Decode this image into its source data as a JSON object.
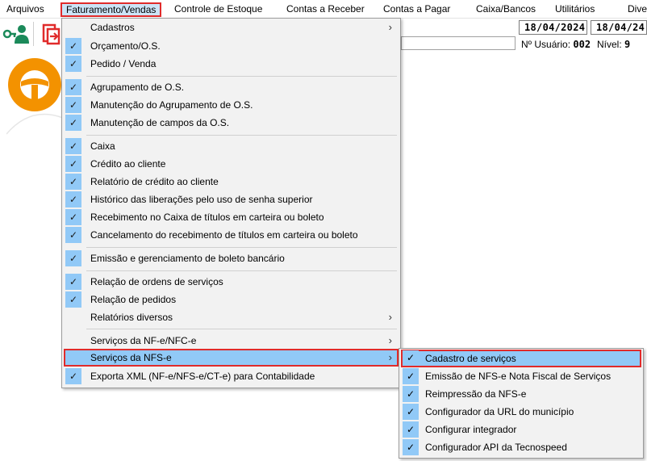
{
  "menubar": {
    "items": [
      {
        "label": "Arquivos"
      },
      {
        "label": "Faturamento/Vendas"
      },
      {
        "label": "Controle de Estoque"
      },
      {
        "label": "Contas a Receber"
      },
      {
        "label": "Contas a Pagar"
      },
      {
        "label": "Caixa/Bancos"
      },
      {
        "label": "Utilitários"
      },
      {
        "label": "Dive"
      }
    ]
  },
  "toolbar": {
    "date1": "18/04/2024",
    "date2": "18/04/24",
    "user_label": "Nº Usuário:",
    "user_value": "002",
    "level_label": "Nível:",
    "level_value": "9"
  },
  "dropdown": {
    "items": [
      {
        "label": "Cadastros",
        "checked": false,
        "submenu": true
      },
      {
        "label": "Orçamento/O.S.",
        "checked": true
      },
      {
        "label": "Pedido / Venda",
        "checked": true
      },
      {
        "label": "Agrupamento de O.S.",
        "checked": true
      },
      {
        "label": "Manutenção do Agrupamento de O.S.",
        "checked": true
      },
      {
        "label": "Manutenção de campos da O.S.",
        "checked": true
      },
      {
        "label": "Caixa",
        "checked": true
      },
      {
        "label": "Crédito ao cliente",
        "checked": true
      },
      {
        "label": "Relatório de crédito ao cliente",
        "checked": true
      },
      {
        "label": "Histórico das liberações pelo uso de senha superior",
        "checked": true
      },
      {
        "label": "Recebimento no Caixa de títulos em carteira ou boleto",
        "checked": true
      },
      {
        "label": "Cancelamento do recebimento de títulos em carteira ou boleto",
        "checked": true
      },
      {
        "label": "Emissão e gerenciamento de boleto bancário",
        "checked": true
      },
      {
        "label": "Relação de ordens de serviços",
        "checked": true
      },
      {
        "label": "Relação de pedidos",
        "checked": true
      },
      {
        "label": "Relatórios diversos",
        "checked": false,
        "submenu": true
      },
      {
        "label": "Serviços da NF-e/NFC-e",
        "checked": false,
        "submenu": true
      },
      {
        "label": "Serviços da NFS-e",
        "checked": false,
        "submenu": true
      },
      {
        "label": "Exporta XML (NF-e/NFS-e/CT-e) para Contabilidade",
        "checked": true
      }
    ]
  },
  "submenu": {
    "items": [
      {
        "label": "Cadastro de serviços"
      },
      {
        "label": "Emissão de NFS-e Nota Fiscal de Serviços"
      },
      {
        "label": "Reimpressão da NFS-e"
      },
      {
        "label": "Configurador da URL do município"
      },
      {
        "label": "Configurar integrador"
      },
      {
        "label": "Configurador API da Tecnospeed"
      }
    ]
  },
  "colors": {
    "highlight": "#91c9f7",
    "active_border": "#e02b2b",
    "logo_orange": "#f39200",
    "user_icon_green": "#1b8a5a",
    "exit_icon_red": "#e02b2b"
  },
  "icons": {
    "check": "✓",
    "submenu_arrow": "›"
  }
}
